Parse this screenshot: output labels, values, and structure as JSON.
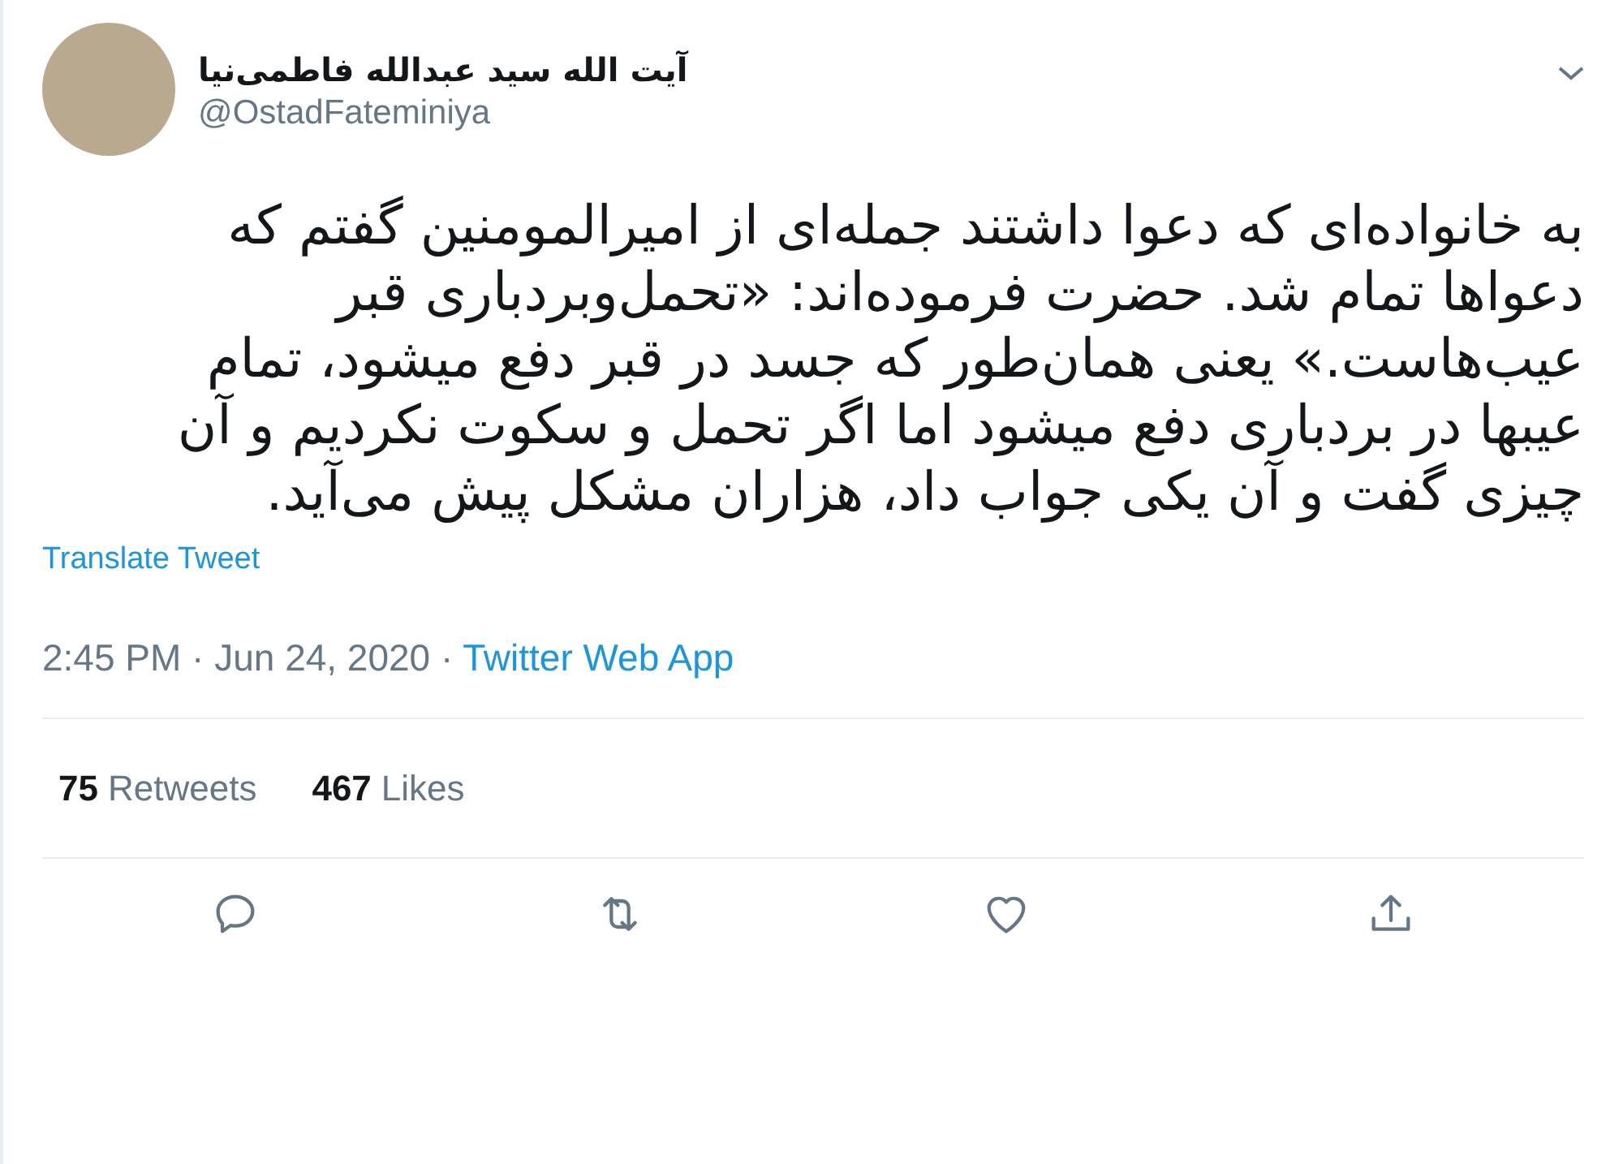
{
  "author": {
    "name": "آیت الله سید عبدالله فاطمی‌نیا",
    "handle": "@OstadFateminiya"
  },
  "body": "به خانواده‌ای که دعوا داشتند جمله‌ای از امیرالمومنین گفتم که دعواها تمام شد. حضرت فرموده‌اند: «تحمل‌وبردباری قبر عیب‌هاست.» یعنی همان‌طور که جسد در قبر دفع میشود، تمام عیبها در بردباری دفع میشود اما اگر تحمل و سکوت نکردیم و آن چیزی گفت و آن یکی جواب داد، هزاران مشکل پیش می‌آید.",
  "translate_link": "Translate Tweet",
  "timestamp": "2:45 PM · Jun 24, 2020 · ",
  "source": "Twitter Web App",
  "retweets": {
    "count": "75",
    "label": "Retweets"
  },
  "likes": {
    "count": "467",
    "label": "Likes"
  }
}
